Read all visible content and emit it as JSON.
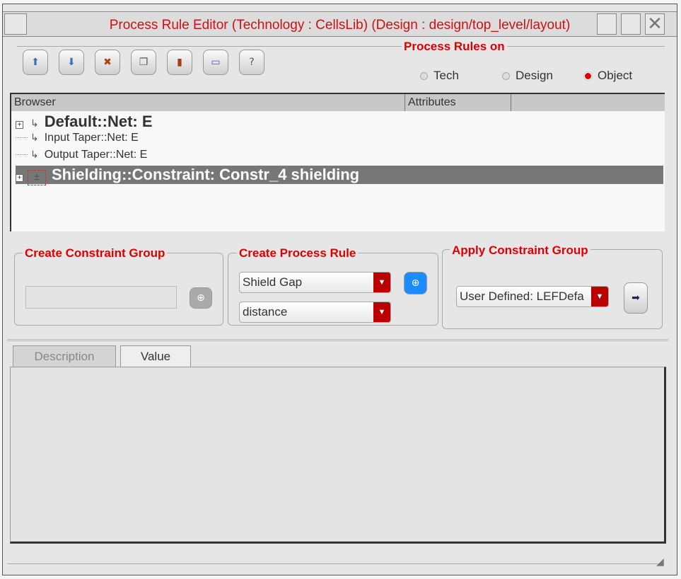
{
  "window": {
    "title": "Process Rule Editor (Technology : CellsLib) (Design : design/top_level/layout)"
  },
  "toolbar": [
    {
      "icon": "move-up-icon",
      "glyph": "⬆"
    },
    {
      "icon": "move-down-icon",
      "glyph": "⬇"
    },
    {
      "icon": "delete-icon",
      "glyph": "✖"
    },
    {
      "icon": "copy-icon",
      "glyph": "❐"
    },
    {
      "icon": "paste-icon",
      "glyph": "▮"
    },
    {
      "icon": "save-icon",
      "glyph": "▭"
    },
    {
      "icon": "help-icon",
      "glyph": "?"
    }
  ],
  "process_rules_on": {
    "label": "Process Rules on",
    "options": [
      "Tech",
      "Design",
      "Object"
    ],
    "selected": "Object"
  },
  "browser": {
    "columns": [
      "Browser",
      "Attributes"
    ],
    "rows": [
      {
        "label": "Default::Net: E",
        "expandable": true,
        "bold": true
      },
      {
        "label": "Input Taper::Net: E",
        "expandable": false
      },
      {
        "label": "Output Taper::Net: E",
        "expandable": false
      },
      {
        "label": "Shielding::Constraint: Constr_4 shielding",
        "expandable": true,
        "bold": true,
        "selected": true
      }
    ]
  },
  "create_constraint_group": {
    "label": "Create Constraint Group",
    "value": ""
  },
  "create_process_rule": {
    "label": "Create Process Rule",
    "rule": "Shield Gap",
    "parameter": "distance"
  },
  "apply_constraint_group": {
    "label": "Apply Constraint Group",
    "value": "User Defined: LEFDefa"
  },
  "tabs": [
    "Description",
    "Value"
  ],
  "colors": {
    "accent": "#d00000",
    "selection": "#777777"
  }
}
